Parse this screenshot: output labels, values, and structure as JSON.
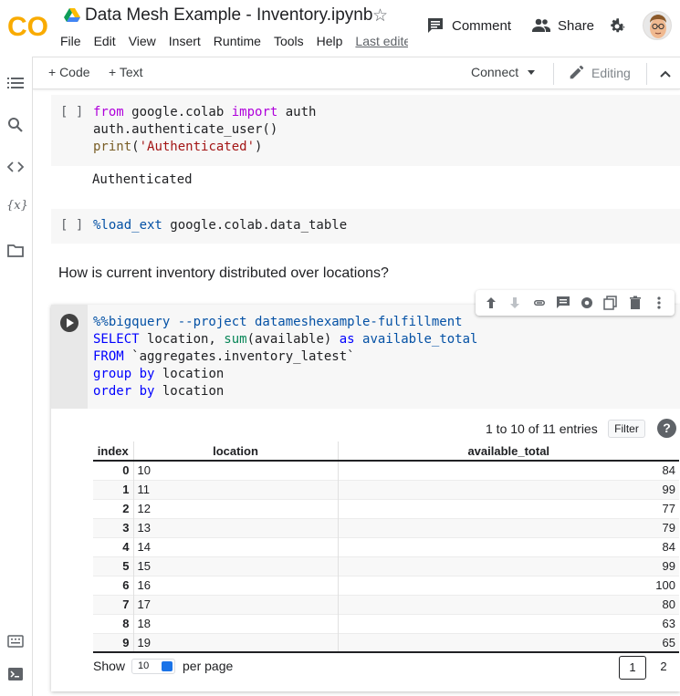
{
  "header": {
    "logo_text": "CO",
    "title": "Data Mesh Example - Inventory.ipynb",
    "menu": [
      "File",
      "Edit",
      "View",
      "Insert",
      "Runtime",
      "Tools",
      "Help"
    ],
    "last_edit": "Last edited",
    "comment_label": "Comment",
    "share_label": "Share"
  },
  "toolbar": {
    "add_code": "+ Code",
    "add_text": "+ Text",
    "connect": "Connect",
    "editing": "Editing"
  },
  "cells": {
    "cell1": {
      "brackets": "[ ]",
      "output": "Authenticated"
    },
    "cell2": {
      "brackets": "[ ]"
    },
    "markdown": "How is current inventory distributed over locations?"
  },
  "datatable": {
    "info": "1 to 10 of 11 entries",
    "filter_label": "Filter",
    "help": "?",
    "columns": [
      "index",
      "location",
      "available_total"
    ],
    "rows": [
      [
        "0",
        "10",
        "84"
      ],
      [
        "1",
        "11",
        "99"
      ],
      [
        "2",
        "12",
        "77"
      ],
      [
        "3",
        "13",
        "79"
      ],
      [
        "4",
        "14",
        "84"
      ],
      [
        "5",
        "15",
        "99"
      ],
      [
        "6",
        "16",
        "100"
      ],
      [
        "7",
        "17",
        "80"
      ],
      [
        "8",
        "18",
        "63"
      ],
      [
        "9",
        "19",
        "65"
      ]
    ],
    "show_label": "Show",
    "per_page_value": "10",
    "per_page_label": "per page",
    "pages": [
      "1",
      "2"
    ]
  },
  "colors": {
    "logo_orange": "#F9AB00",
    "logo_dark_orange": "#E8710A",
    "keyword_purple": "#AF00DB",
    "keyword_blue": "#0000FF"
  }
}
